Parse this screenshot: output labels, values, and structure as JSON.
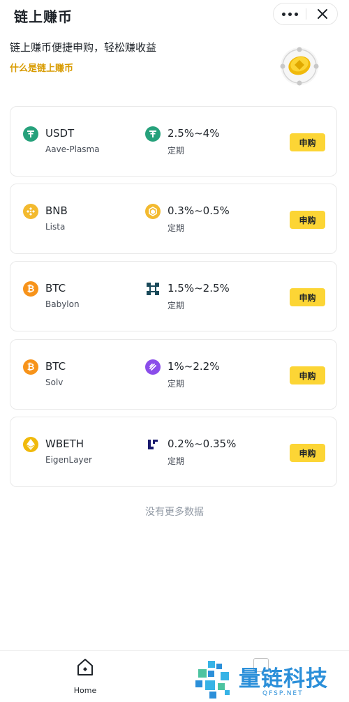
{
  "header": {
    "title": "链上赚币",
    "more_icon": "more-horizontal-icon",
    "close_icon": "close-icon"
  },
  "intro": {
    "text": "链上赚币便捷申购，轻松赚收益",
    "link": "什么是链上赚币",
    "link_color": "#d89b00"
  },
  "products": [
    {
      "asset": "USDT",
      "asset_icon": "tether-icon",
      "asset_color": "#26a17b",
      "platform": "Aave-Plasma",
      "protocol_icon": "tether-icon",
      "apy": "2.5%~4%",
      "term": "定期",
      "button": "申购"
    },
    {
      "asset": "BNB",
      "asset_icon": "bnb-icon",
      "asset_color": "#f3ba2f",
      "platform": "Lista",
      "protocol_icon": "lista-icon",
      "apy": "0.3%~0.5%",
      "term": "定期",
      "button": "申购"
    },
    {
      "asset": "BTC",
      "asset_icon": "bitcoin-icon",
      "asset_color": "#f7931a",
      "platform": "Babylon",
      "protocol_icon": "babylon-icon",
      "apy": "1.5%~2.5%",
      "term": "定期",
      "button": "申购"
    },
    {
      "asset": "BTC",
      "asset_icon": "bitcoin-icon",
      "asset_color": "#f7931a",
      "platform": "Solv",
      "protocol_icon": "solv-icon",
      "apy": "1%~2.2%",
      "term": "定期",
      "button": "申购"
    },
    {
      "asset": "WBETH",
      "asset_icon": "ethereum-icon",
      "asset_color": "#f0b90b",
      "platform": "EigenLayer",
      "protocol_icon": "eigenlayer-icon",
      "apy": "0.2%~0.35%",
      "term": "定期",
      "button": "申购"
    }
  ],
  "footer_note": "没有更多数据",
  "tabbar": {
    "home_label": "Home"
  },
  "watermark": {
    "name": "量链科技",
    "url": "QFSP.NET"
  },
  "colors": {
    "accent": "#fcd535",
    "text": "#1e2329",
    "muted": "#929aa5"
  }
}
